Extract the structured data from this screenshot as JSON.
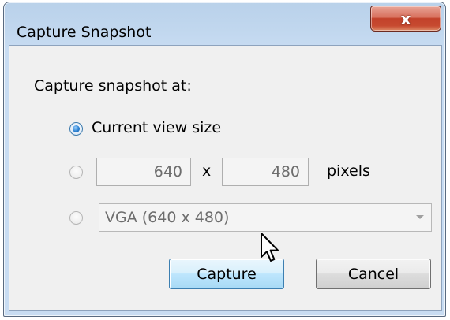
{
  "window": {
    "title": "Capture Snapshot",
    "close_glyph": "x"
  },
  "dialog": {
    "prompt": "Capture snapshot at:",
    "options": {
      "current_view": {
        "label": "Current view size",
        "selected": true
      },
      "custom_size": {
        "width_value": "640",
        "separator": "x",
        "height_value": "480",
        "unit_label": "pixels",
        "selected": false
      },
      "preset": {
        "selected_value": "VGA (640 x 480)",
        "selected": false
      }
    }
  },
  "buttons": {
    "capture_label": "Capture",
    "cancel_label": "Cancel"
  },
  "icons": {
    "close": "close-icon",
    "dropdown": "chevron-down-icon",
    "cursor": "mouse-pointer-icon"
  }
}
